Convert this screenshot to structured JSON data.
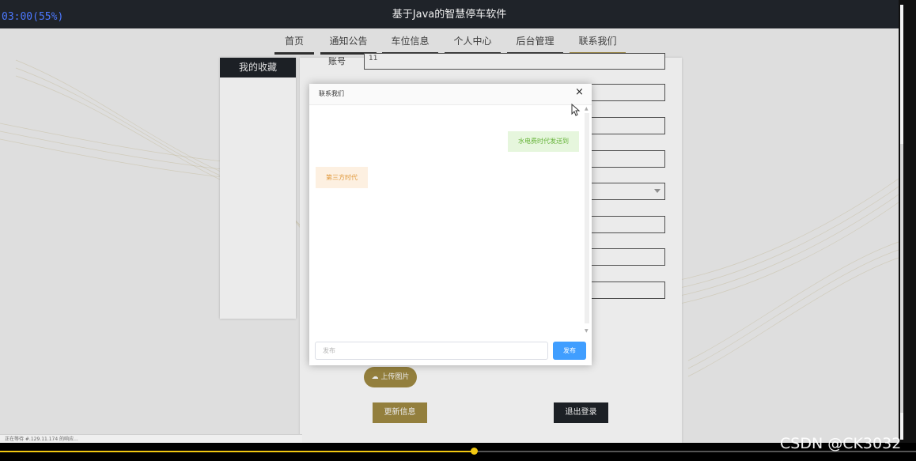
{
  "app": {
    "title": "基于Java的智慧停车软件",
    "timer": "03:00(55%)"
  },
  "nav": {
    "tabs": [
      {
        "label": "首页",
        "active": false
      },
      {
        "label": "通知公告",
        "active": false
      },
      {
        "label": "车位信息",
        "active": false
      },
      {
        "label": "个人中心",
        "active": false
      },
      {
        "label": "后台管理",
        "active": false
      },
      {
        "label": "联系我们",
        "active": true
      }
    ]
  },
  "sidebar": {
    "title": "我的收藏"
  },
  "profile": {
    "account_label": "账号",
    "account_value": "11",
    "upload_label": "上传图片",
    "update_label": "更新信息",
    "logout_label": "退出登录"
  },
  "modal": {
    "title": "联系我们",
    "close": "×",
    "messages": [
      {
        "side": "right",
        "text": "水电费时代发送到"
      },
      {
        "side": "left",
        "text": "第三方时代"
      }
    ],
    "input_placeholder": "发布",
    "post_label": "发布"
  },
  "status": {
    "text": "正在等待 #.129.11.174 的响应..."
  },
  "video": {
    "progress": 0.518
  },
  "watermark": {
    "text": "CSDN @CK3032"
  },
  "colors": {
    "accent_gold": "#a08a43",
    "dark": "#1f2329",
    "blue": "#409eff",
    "progress": "#f2c811"
  }
}
